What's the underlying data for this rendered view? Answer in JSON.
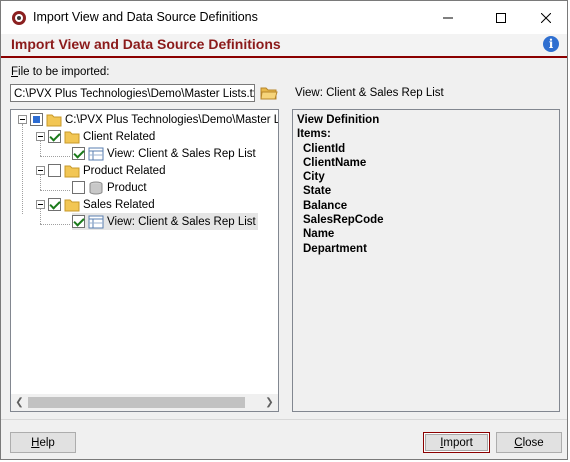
{
  "window": {
    "title": "Import View and Data Source Definitions",
    "header_title": "Import View and Data Source Definitions"
  },
  "file": {
    "label_accel": "F",
    "label_rest": "ile to be imported:",
    "value": "C:\\PVX Plus Technologies\\Demo\\Master Lists.txt"
  },
  "view_label": "View: Client & Sales Rep List",
  "tree": {
    "root": "C:\\PVX Plus Technologies\\Demo\\Master List",
    "nodes": [
      {
        "label": "Client Related"
      },
      {
        "label": "View: Client & Sales Rep List"
      },
      {
        "label": "Product Related"
      },
      {
        "label": "Product"
      },
      {
        "label": "Sales Related"
      },
      {
        "label": "View: Client & Sales Rep List"
      }
    ]
  },
  "definition": {
    "heading": "View Definition",
    "items_label": "Items:",
    "items": [
      "ClientId",
      "ClientName",
      "City",
      "State",
      "Balance",
      "SalesRepCode",
      "Name",
      "Department"
    ]
  },
  "buttons": {
    "help_accel": "H",
    "help_rest": "elp",
    "import_accel": "I",
    "import_rest": "mport",
    "close_accel": "C",
    "close_rest": "lose"
  },
  "colors": {
    "header_text": "#8b1a1a",
    "header_rule": "#8b0000",
    "check": "#1a7a1a",
    "info": "#2f6fd0"
  }
}
